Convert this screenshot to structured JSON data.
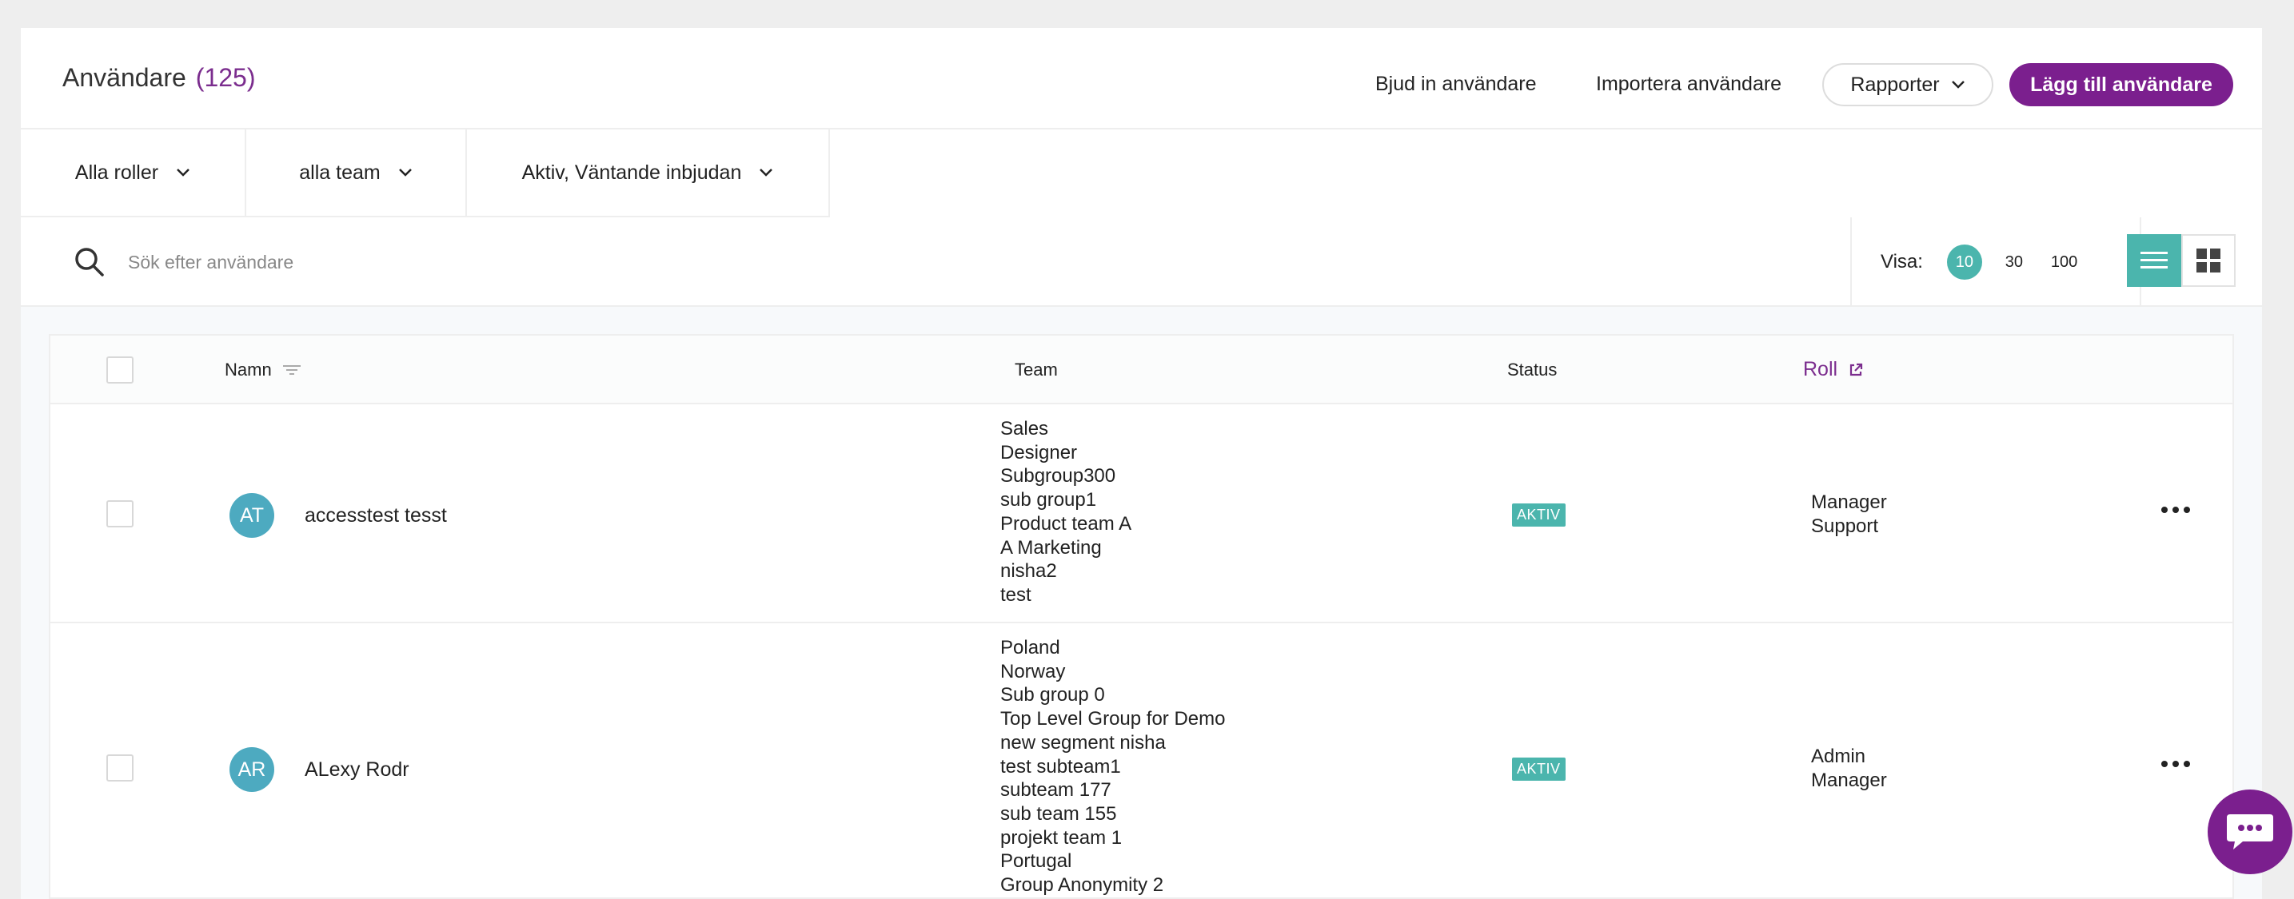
{
  "header": {
    "title": "Användare",
    "count": "(125)",
    "invite_label": "Bjud in användare",
    "import_label": "Importera användare",
    "reports_label": "Rapporter",
    "add_label": "Lägg till användare"
  },
  "filters": [
    {
      "label": "Alla roller"
    },
    {
      "label": "alla team"
    },
    {
      "label": "Aktiv, Väntande inbjudan"
    }
  ],
  "search": {
    "placeholder": "Sök efter användare",
    "value": ""
  },
  "pagination": {
    "label": "Visa:",
    "options": [
      "10",
      "30",
      "100"
    ],
    "selected": "10"
  },
  "view": {
    "selected": "list"
  },
  "table": {
    "headers": {
      "name": "Namn",
      "team": "Team",
      "status": "Status",
      "role": "Roll"
    },
    "rows": [
      {
        "initials": "AT",
        "name": "accesstest tesst",
        "teams": [
          "Sales",
          "Designer",
          "Subgroup300",
          "sub group1",
          "Product team A",
          "A Marketing",
          "nisha2",
          "test"
        ],
        "status": "AKTIV",
        "roles": [
          "Manager",
          "Support"
        ]
      },
      {
        "initials": "AR",
        "name": "ALexy Rodr",
        "teams": [
          "Poland",
          "Norway",
          "Sub group 0",
          "Top Level Group for Demo",
          "new segment nisha",
          "test subteam1",
          "subteam 177",
          "sub team 155",
          "projekt team 1",
          "Portugal",
          "Group Anonymity 2"
        ],
        "status": "AKTIV",
        "roles": [
          "Admin",
          "Manager"
        ]
      }
    ]
  },
  "colors": {
    "brand": "#7b1f8e",
    "accent": "#4bb5ad",
    "avatar": "#4daac0"
  }
}
